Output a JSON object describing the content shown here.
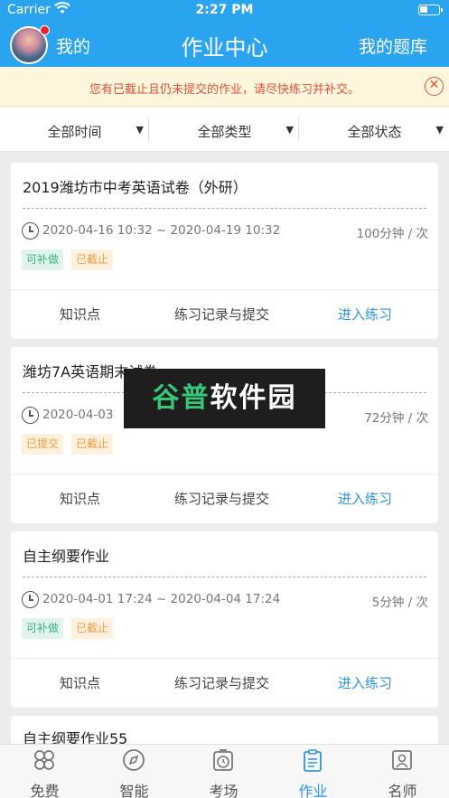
{
  "status_bar": {
    "carrier": "Carrier",
    "time": "2:27 PM"
  },
  "header": {
    "my_label": "我的",
    "title": "作业中心",
    "my_bank": "我的题库"
  },
  "notice": {
    "text": "您有已截止且仍未提交的作业，请尽快练习并补交。"
  },
  "filters": [
    {
      "label": "全部时间"
    },
    {
      "label": "全部类型"
    },
    {
      "label": "全部状态"
    }
  ],
  "cards": [
    {
      "title": "2019潍坊市中考英语试卷（外研）",
      "period": "2020-04-16 10:32 ~ 2020-04-19 10:32",
      "duration": "100分钟 / 次",
      "badges": [
        "可补做",
        "已截止"
      ],
      "actions": [
        "知识点",
        "练习记录与提交",
        "进入练习"
      ]
    },
    {
      "title": "潍坊7A英语期末试卷",
      "period": "2020-04-03",
      "duration": "72分钟 / 次",
      "badges": [
        "已提交",
        "已截止"
      ],
      "actions": [
        "知识点",
        "练习记录与提交",
        "进入练习"
      ]
    },
    {
      "title": "自主纲要作业",
      "period": "2020-04-01 17:24 ~ 2020-04-04 17:24",
      "duration": "5分钟 / 次",
      "badges": [
        "可补做",
        "已截止"
      ],
      "actions": [
        "知识点",
        "练习记录与提交",
        "进入练习"
      ]
    },
    {
      "title": "自主纲要作业55"
    }
  ],
  "watermark": {
    "part1": "谷普",
    "part2": "软件园"
  },
  "tabs": [
    {
      "label": "免费",
      "icon": "grid-icon"
    },
    {
      "label": "智能",
      "icon": "compass-icon"
    },
    {
      "label": "考场",
      "icon": "timer-icon"
    },
    {
      "label": "作业",
      "icon": "clipboard-icon"
    },
    {
      "label": "名师",
      "icon": "teacher-icon"
    }
  ],
  "colors": {
    "accent": "#2aa4ee",
    "link": "#2a95e6",
    "warning": "#e0523a"
  }
}
